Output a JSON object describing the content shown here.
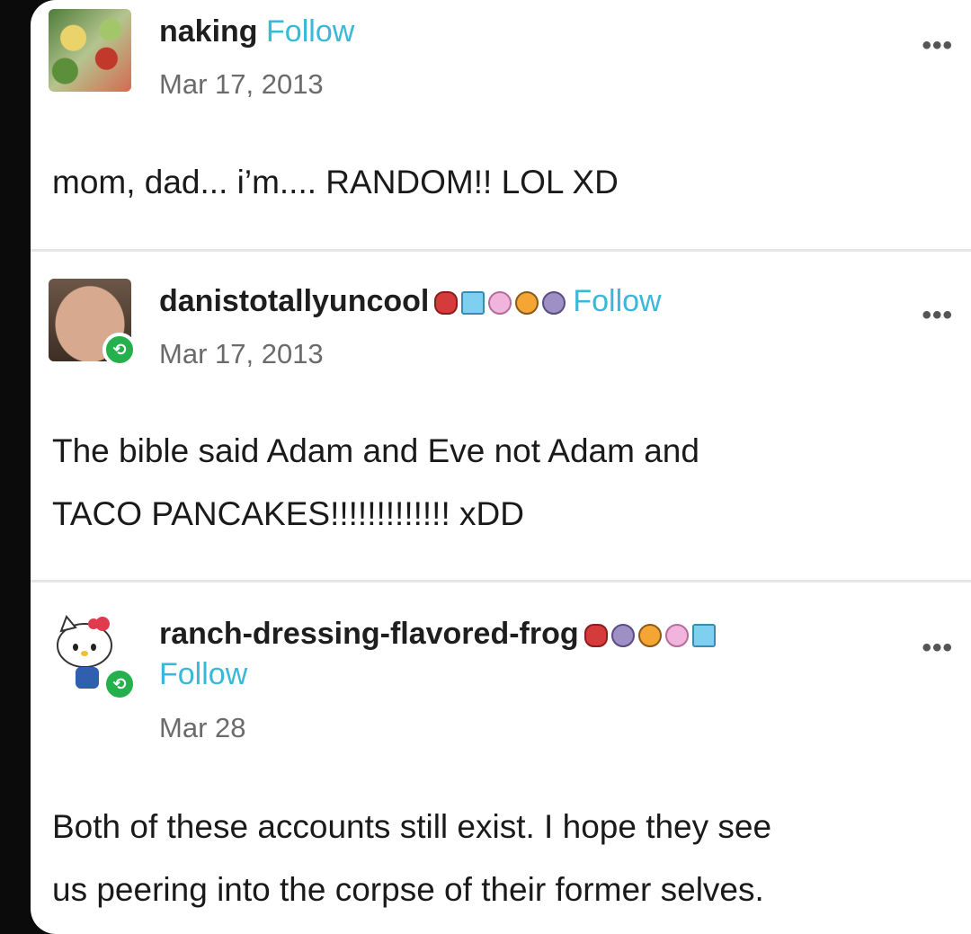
{
  "posts": [
    {
      "username": "naking",
      "follow_label": "Follow",
      "date": "Mar 17, 2013",
      "body": "mom, dad... i’m.... RANDOM!! LOL XD",
      "more_label": "•••"
    },
    {
      "username": "danistotallyuncool",
      "follow_label": "Follow",
      "date": "Mar 17, 2013",
      "body_lines": [
        "The bible said Adam and Eve not Adam and",
        "TACO PANCAKES!!!!!!!!!!!!! xDD"
      ],
      "more_label": "•••",
      "badges": [
        "red-hex-badge",
        "blue-badge",
        "pink-paw-badge",
        "orange-paw-badge",
        "purple-badge"
      ]
    },
    {
      "username": "ranch-dressing-flavored-frog",
      "follow_label": "Follow",
      "date": "Mar 28",
      "body_lines": [
        "Both of these accounts still exist. I hope they see",
        "us peering into the corpse of their former selves."
      ],
      "more_label": "•••",
      "badges": [
        "red-hex-badge",
        "purple-badge",
        "orange-paw-badge",
        "pink-paw-badge",
        "blue-badge"
      ]
    }
  ],
  "colors": {
    "follow": "#39b8d9",
    "reblog_badge": "#24b04d",
    "date": "#6b6b6b"
  },
  "icons": {
    "reblog": "reblog-icon",
    "more": "more-options-icon"
  }
}
